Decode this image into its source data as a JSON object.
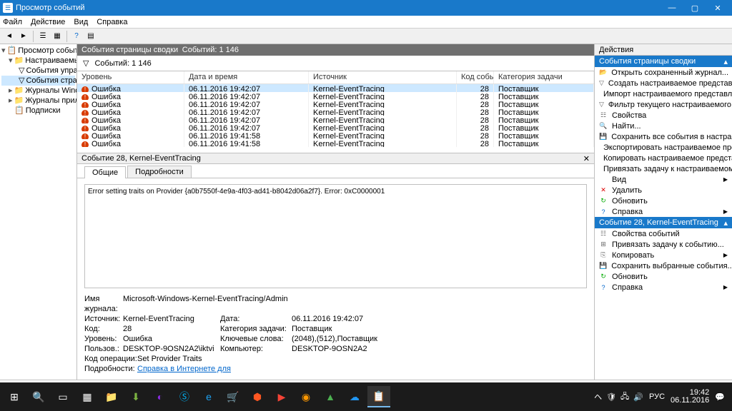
{
  "window": {
    "title": "Просмотр событий"
  },
  "menu": [
    "Файл",
    "Действие",
    "Вид",
    "Справка"
  ],
  "tree": {
    "root": "Просмотр событий (Локальн",
    "custom": "Настраиваемые представл",
    "custom_children": [
      "События управления",
      "События страницы свод"
    ],
    "winlogs": "Журналы Windows",
    "applogs": "Журналы приложений и сл",
    "subs": "Подписки"
  },
  "center_header": {
    "title": "События страницы сводки",
    "count_label": "Событий: 1 146"
  },
  "filter": {
    "count_label": "Событий: 1 146"
  },
  "columns": {
    "level": "Уровень",
    "datetime": "Дата и время",
    "source": "Источник",
    "id": "Код события",
    "cat": "Категория задачи"
  },
  "rows": [
    {
      "level": "Ошибка",
      "dt": "06.11.2016 19:42:07",
      "src": "Kernel-EventTracing",
      "id": "28",
      "cat": "Поставщик"
    },
    {
      "level": "Ошибка",
      "dt": "06.11.2016 19:42:07",
      "src": "Kernel-EventTracing",
      "id": "28",
      "cat": "Поставщик"
    },
    {
      "level": "Ошибка",
      "dt": "06.11.2016 19:42:07",
      "src": "Kernel-EventTracing",
      "id": "28",
      "cat": "Поставщик"
    },
    {
      "level": "Ошибка",
      "dt": "06.11.2016 19:42:07",
      "src": "Kernel-EventTracing",
      "id": "28",
      "cat": "Поставщик"
    },
    {
      "level": "Ошибка",
      "dt": "06.11.2016 19:42:07",
      "src": "Kernel-EventTracing",
      "id": "28",
      "cat": "Поставщик"
    },
    {
      "level": "Ошибка",
      "dt": "06.11.2016 19:42:07",
      "src": "Kernel-EventTracing",
      "id": "28",
      "cat": "Поставщик"
    },
    {
      "level": "Ошибка",
      "dt": "06.11.2016 19:41:58",
      "src": "Kernel-EventTracing",
      "id": "28",
      "cat": "Поставщик"
    },
    {
      "level": "Ошибка",
      "dt": "06.11.2016 19:41:58",
      "src": "Kernel-EventTracing",
      "id": "28",
      "cat": "Поставщик"
    }
  ],
  "pane": {
    "title": "Событие 28, Kernel-EventTracing"
  },
  "detail_tabs": {
    "general": "Общие",
    "details": "Подробности"
  },
  "detail_msg": "Error setting traits on Provider {a0b7550f-4e9a-4f03-ad41-b8042d06a2f7}. Error: 0xC0000001",
  "props": {
    "logname_l": "Имя журнала:",
    "logname_v": "Microsoft-Windows-Kernel-EventTracing/Admin",
    "source_l": "Источник:",
    "source_v": "Kernel-EventTracing",
    "date_l": "Дата:",
    "date_v": "06.11.2016 19:42:07",
    "id_l": "Код:",
    "id_v": "28",
    "cat_l": "Категория задачи:",
    "cat_v": "Поставщик",
    "level_l": "Уровень:",
    "level_v": "Ошибка",
    "kw_l": "Ключевые слова:",
    "kw_v": "(2048),(512),Поставщик",
    "user_l": "Пользов.:",
    "user_v": "DESKTOP-9OSN2A2\\iktvi",
    "comp_l": "Компьютер:",
    "comp_v": "DESKTOP-9OSN2A2",
    "op_l": "Код операции:",
    "op_v": "Set Provider Traits",
    "more_l": "Подробности:",
    "more_link": "Справка в Интернете для "
  },
  "actions": {
    "header": "Действия",
    "section1": "События страницы сводки",
    "items1": [
      {
        "icon": "📂",
        "label": "Открыть сохраненный журнал..."
      },
      {
        "icon": "▽",
        "label": "Создать настраиваемое представление..."
      },
      {
        "icon": "",
        "label": "Импорт настраиваемого представления..."
      },
      {
        "icon": "▽",
        "label": "Фильтр текущего настраиваемого представления..."
      },
      {
        "icon": "☷",
        "label": "Свойства"
      },
      {
        "icon": "🔍",
        "label": "Найти..."
      },
      {
        "icon": "💾",
        "label": "Сохранить все события в настраиваемом представл..."
      },
      {
        "icon": "",
        "label": "Экспортировать настраиваемое представление..."
      },
      {
        "icon": "",
        "label": "Копировать настраиваемое представление..."
      },
      {
        "icon": "",
        "label": "Привязать задачу к настраиваемому представлени..."
      },
      {
        "icon": "",
        "label": "Вид",
        "arrow": true
      },
      {
        "icon": "✕",
        "label": "Удалить",
        "color": "#d00"
      },
      {
        "icon": "↻",
        "label": "Обновить",
        "color": "#0a0"
      },
      {
        "icon": "?",
        "label": "Справка",
        "color": "#06c",
        "arrow": true
      }
    ],
    "section2": "Событие 28, Kernel-EventTracing",
    "items2": [
      {
        "icon": "☷",
        "label": "Свойства событий"
      },
      {
        "icon": "⊞",
        "label": "Привязать задачу к событию..."
      },
      {
        "icon": "⎘",
        "label": "Копировать",
        "arrow": true
      },
      {
        "icon": "💾",
        "label": "Сохранить выбранные события..."
      },
      {
        "icon": "↻",
        "label": "Обновить",
        "color": "#0a0"
      },
      {
        "icon": "?",
        "label": "Справка",
        "color": "#06c",
        "arrow": true
      }
    ]
  },
  "taskbar": {
    "lang": "РУС",
    "time": "19:42",
    "date": "06.11.2016"
  }
}
